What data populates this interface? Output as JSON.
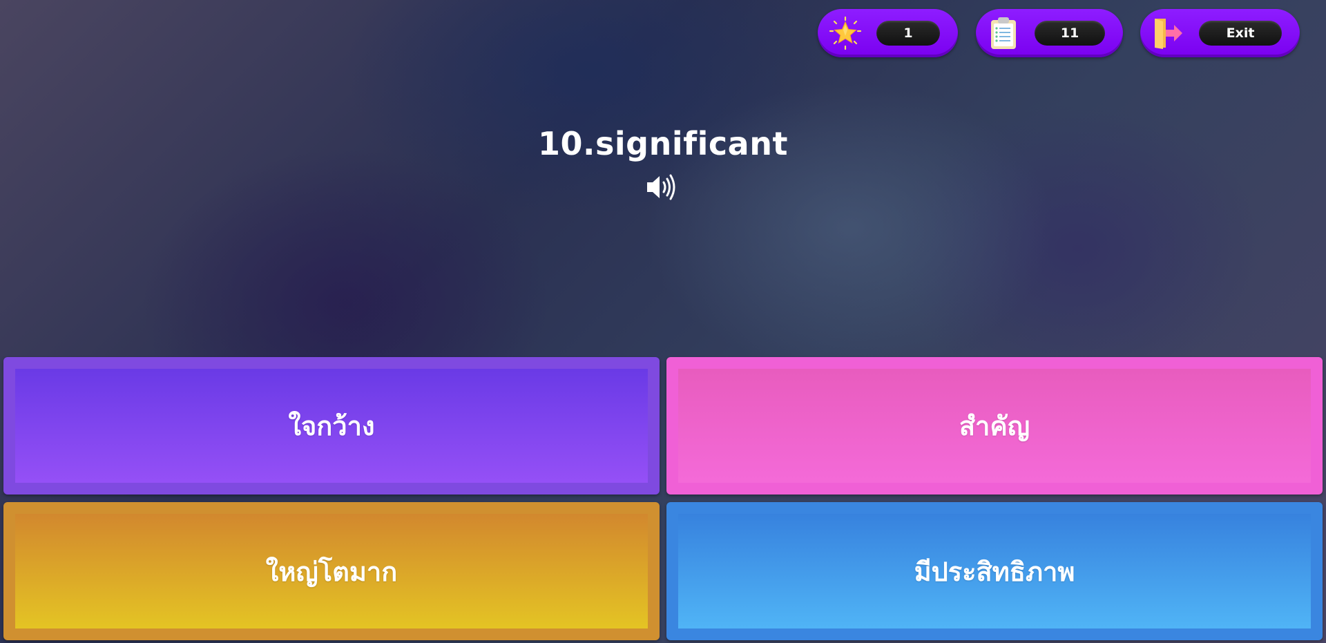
{
  "hud": {
    "stars": {
      "icon": "star-icon",
      "value": "1"
    },
    "questions": {
      "icon": "clipboard-icon",
      "value": "11"
    },
    "exit": {
      "icon": "exit-door-icon",
      "label": "Exit"
    }
  },
  "question": {
    "text": "10.significant",
    "audio_icon": "speaker-icon"
  },
  "answers": [
    {
      "label": "ใจกว้าง",
      "color": "#7f4ae0"
    },
    {
      "label": "สำคัญ",
      "color": "#f060d6"
    },
    {
      "label": "ใหญ่โตมาก",
      "color": "#d09030"
    },
    {
      "label": "มีประสิทธิภาพ",
      "color": "#3a86e0"
    }
  ],
  "colors": {
    "hud_pill": "#8e1dff",
    "hud_value_bg": "#111111"
  }
}
